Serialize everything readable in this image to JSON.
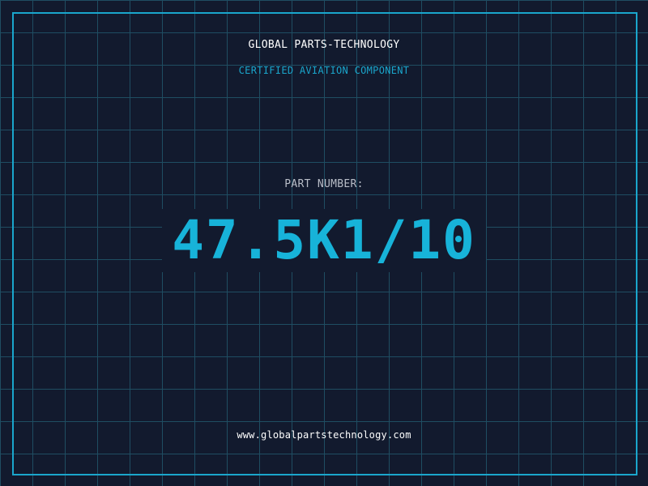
{
  "header": {
    "company": "GLOBAL PARTS-TECHNOLOGY",
    "subtitle": "CERTIFIED AVIATION COMPONENT"
  },
  "part": {
    "label": "PART NUMBER:",
    "number": "47.5K1/10"
  },
  "footer": {
    "website": "www.globalpartstechnology.com"
  },
  "colors": {
    "background": "#121a2e",
    "grid": "#1f4d62",
    "accent": "#1aa6cc",
    "part_number": "#17b3d9",
    "label": "#b9bec8",
    "text": "#ffffff"
  }
}
